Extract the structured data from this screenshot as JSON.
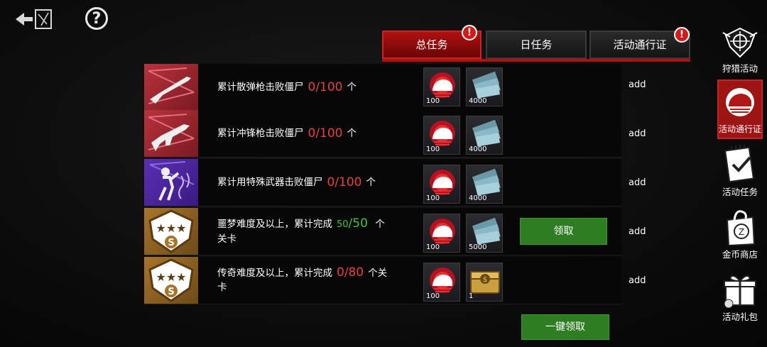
{
  "header": {
    "back_icon": "back-arrow-icon",
    "help_label": "?"
  },
  "tabs": [
    {
      "label": "总任务",
      "active": true,
      "badge": "!"
    },
    {
      "label": "日任务",
      "active": false,
      "badge": ""
    },
    {
      "label": "活动通行证",
      "active": false,
      "badge": "!"
    }
  ],
  "tasks": [
    {
      "icon": "shotgun-icon",
      "pre": "累计散弹枪击败僵尸",
      "progress": "0/100",
      "unit": "个",
      "done": false,
      "rewards": [
        {
          "icon": "bison-badge-icon",
          "qty": "100"
        },
        {
          "icon": "cash-stack-icon",
          "qty": "4000"
        }
      ],
      "add": "add",
      "claim": ""
    },
    {
      "icon": "smg-icon",
      "pre": "累计冲锋枪击败僵尸",
      "progress": "0/100",
      "unit": "个",
      "done": false,
      "rewards": [
        {
          "icon": "bison-badge-icon",
          "qty": "100"
        },
        {
          "icon": "cash-stack-icon",
          "qty": "4000"
        }
      ],
      "add": "add",
      "claim": ""
    },
    {
      "icon": "electrocuted-zombie-icon",
      "pre": "累计用特殊武器击败僵尸",
      "progress": "0/100",
      "unit": "个",
      "done": false,
      "rewards": [
        {
          "icon": "bison-badge-icon",
          "qty": "100"
        },
        {
          "icon": "cash-stack-icon",
          "qty": "4000"
        }
      ],
      "add": "add",
      "claim": ""
    },
    {
      "icon": "three-star-s-badge-icon",
      "pre": "噩梦难度及以上，累计完成",
      "progress_done": "50",
      "progress_total": "/50",
      "unit": "个",
      "line2": "关卡",
      "done": true,
      "rewards": [
        {
          "icon": "bison-badge-icon",
          "qty": "100"
        },
        {
          "icon": "cash-stack-icon",
          "qty": "5000"
        }
      ],
      "add": "add",
      "claim": "领取"
    },
    {
      "icon": "three-star-s-badge-icon",
      "pre": "传奇难度及以上，累计完成",
      "progress": "0/80",
      "unit": "个关",
      "line2": "卡",
      "done": false,
      "rewards": [
        {
          "icon": "bison-badge-icon",
          "qty": "100"
        },
        {
          "icon": "gold-chest-icon",
          "qty": "1"
        }
      ],
      "add": "add",
      "claim": ""
    }
  ],
  "claim_all": "一键领取",
  "side_nav": [
    {
      "icon": "hunting-emblem-icon",
      "label": "狩猎活动",
      "active": false
    },
    {
      "icon": "bison-pass-icon",
      "label": "活动通行证",
      "active": true
    },
    {
      "icon": "task-notepad-icon",
      "label": "活动任务",
      "active": false
    },
    {
      "icon": "gold-shop-bag-icon",
      "label": "金币商店",
      "active": false
    },
    {
      "icon": "gift-pack-icon",
      "label": "活动礼包",
      "active": false
    }
  ],
  "colors": {
    "accent_red": "#b01010",
    "progress_red": "#e84040",
    "progress_green": "#3ec83e",
    "claim_green": "#2e7d22"
  }
}
